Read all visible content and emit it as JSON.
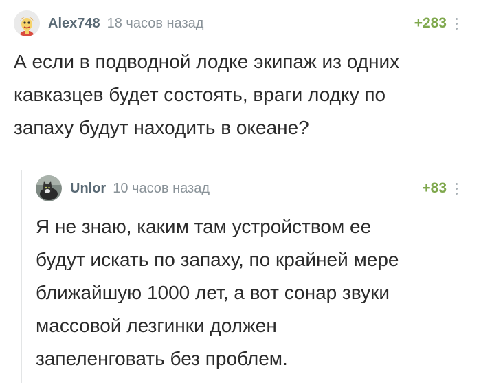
{
  "comments": [
    {
      "author": "Alex748",
      "time": "18 часов назад",
      "rating": "+283",
      "text": "А если в подводной лодке экипаж из одних\nкавказцев будет состоять, враги лодку по\nзапаху будут находить в океане?",
      "avatar_icon": "cartoon-character-avatar"
    },
    {
      "author": "Unlor",
      "time": "10 часов назад",
      "rating": "+83",
      "text": "Я не знаю, каким там устройством ее\nбудут искать по запаху, по крайней мере\nближайшую 1000 лет, а вот сонар звуки\nмассовой лезгинки должен\nзапеленговать без проблем.",
      "avatar_icon": "cat-photo-avatar"
    }
  ],
  "colors": {
    "author": "#5a6a75",
    "time": "#8a9399",
    "rating": "#7fa84d",
    "text": "#2b2b2b",
    "thread_line": "#e3e5e6"
  }
}
